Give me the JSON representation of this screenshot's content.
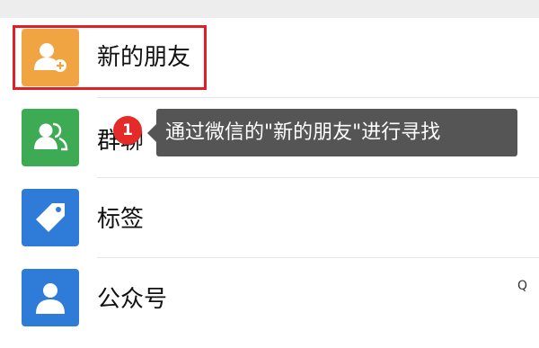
{
  "contacts": {
    "items": [
      {
        "label": "新的朋友",
        "icon": "add-friend-icon",
        "color": "#F0A442"
      },
      {
        "label": "群聊",
        "icon": "group-chat-icon",
        "color": "#3DAA54"
      },
      {
        "label": "标签",
        "icon": "tag-icon",
        "color": "#2F7BD8"
      },
      {
        "label": "公众号",
        "icon": "official-account-icon",
        "color": "#2F7BD8"
      }
    ]
  },
  "annotation": {
    "step_number": "1",
    "tooltip_text": "通过微信的\"新的朋友\"进行寻找",
    "highlight_color": "#E11F26"
  },
  "side_index": {
    "search_glyph": "Q"
  }
}
